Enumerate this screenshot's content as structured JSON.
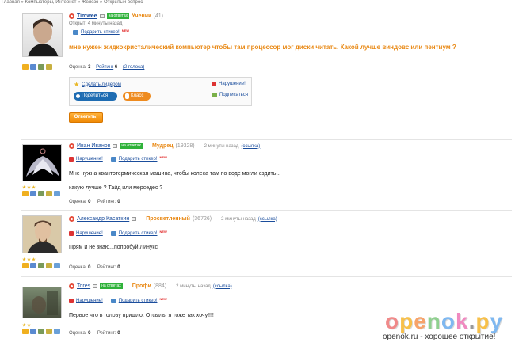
{
  "breadcrumb": "Главная » Компьютеры, Интернет » Железо » Открытый вопрос",
  "question": {
    "author": "Timwee",
    "online": "на ответах",
    "rank": "Ученик",
    "rank_num": "(41)",
    "opened": "Открыт: 4 минуты назад",
    "gift": "Подарить стикер!",
    "new": "NEW",
    "text": "мне нужен жидкокристалический компьютер чтобы там процессор мог диски читать. Какой лучше виндовс или пентиум ?",
    "score_label": "Оценка:",
    "score": "3",
    "rating_label": "Рейтинг",
    "rating": "6",
    "votes": "(2 голоса)",
    "make_leader": "Сделать лидером",
    "violation": "Нарушение!",
    "subscribe": "Подписаться",
    "share": "Поделиться",
    "klass": "Класс",
    "answer_button": "Ответить!"
  },
  "answers": [
    {
      "author": "Иван Иванов",
      "online": "на ответах",
      "rank": "Мудрец",
      "rank_num": "(19328)",
      "time": "2 минуты назад",
      "link": "(ссылка)",
      "violation": "Нарушение!",
      "gift": "Подарить стикер!",
      "new": "NEW",
      "text1": "Мне нужна квантотермическая машина, чтобы колеса там по воде могли ездить...",
      "text2": "какую лучше ? Тайд или мерседес ?",
      "score_label": "Оценка:",
      "score": "0",
      "rating_label": "Рейтинг:",
      "rating": "0"
    },
    {
      "author": "Александр Касаткин",
      "rank": "Просветленный",
      "rank_num": "(36726)",
      "time": "2 минуты назад",
      "link": "(ссылка)",
      "violation": "Нарушение!",
      "gift": "Подарить стикер!",
      "new": "NEW",
      "text1": "Прям и не знаю...попробуй Линукс",
      "score_label": "Оценка:",
      "score": "0",
      "rating_label": "Рейтинг:",
      "rating": "0"
    },
    {
      "author": "Tores",
      "online": "на ответах",
      "rank": "Профи",
      "rank_num": "(884)",
      "time": "2 минуты назад",
      "link": "(ссылка)",
      "violation": "Нарушение!",
      "gift": "Подарить стикер!",
      "new": "NEW",
      "text1": "Первое что в голову пришло: Отсыль, я тоже так хочу!!!!",
      "score_label": "Оценка:",
      "score": "0",
      "rating_label": "Рейтинг:",
      "rating": "0"
    }
  ],
  "watermark": {
    "logo": [
      "o",
      "p",
      "e",
      "n",
      "o",
      "k",
      ".",
      "p",
      "y"
    ],
    "logo_colors": [
      "#f08a8a",
      "#f7c04a",
      "#f7a36a",
      "#8fd08f",
      "#7fb8f0",
      "#f08ac0",
      "#999999",
      "#f7c04a",
      "#7fb8f0"
    ],
    "caption": "openok.ru - хорошее открытие!"
  },
  "colors": {
    "accent": "#e98a17",
    "link": "#1a4d9c",
    "online": "#2fb23a",
    "share": "#1e6cb2",
    "klass": "#ee8b1f"
  }
}
